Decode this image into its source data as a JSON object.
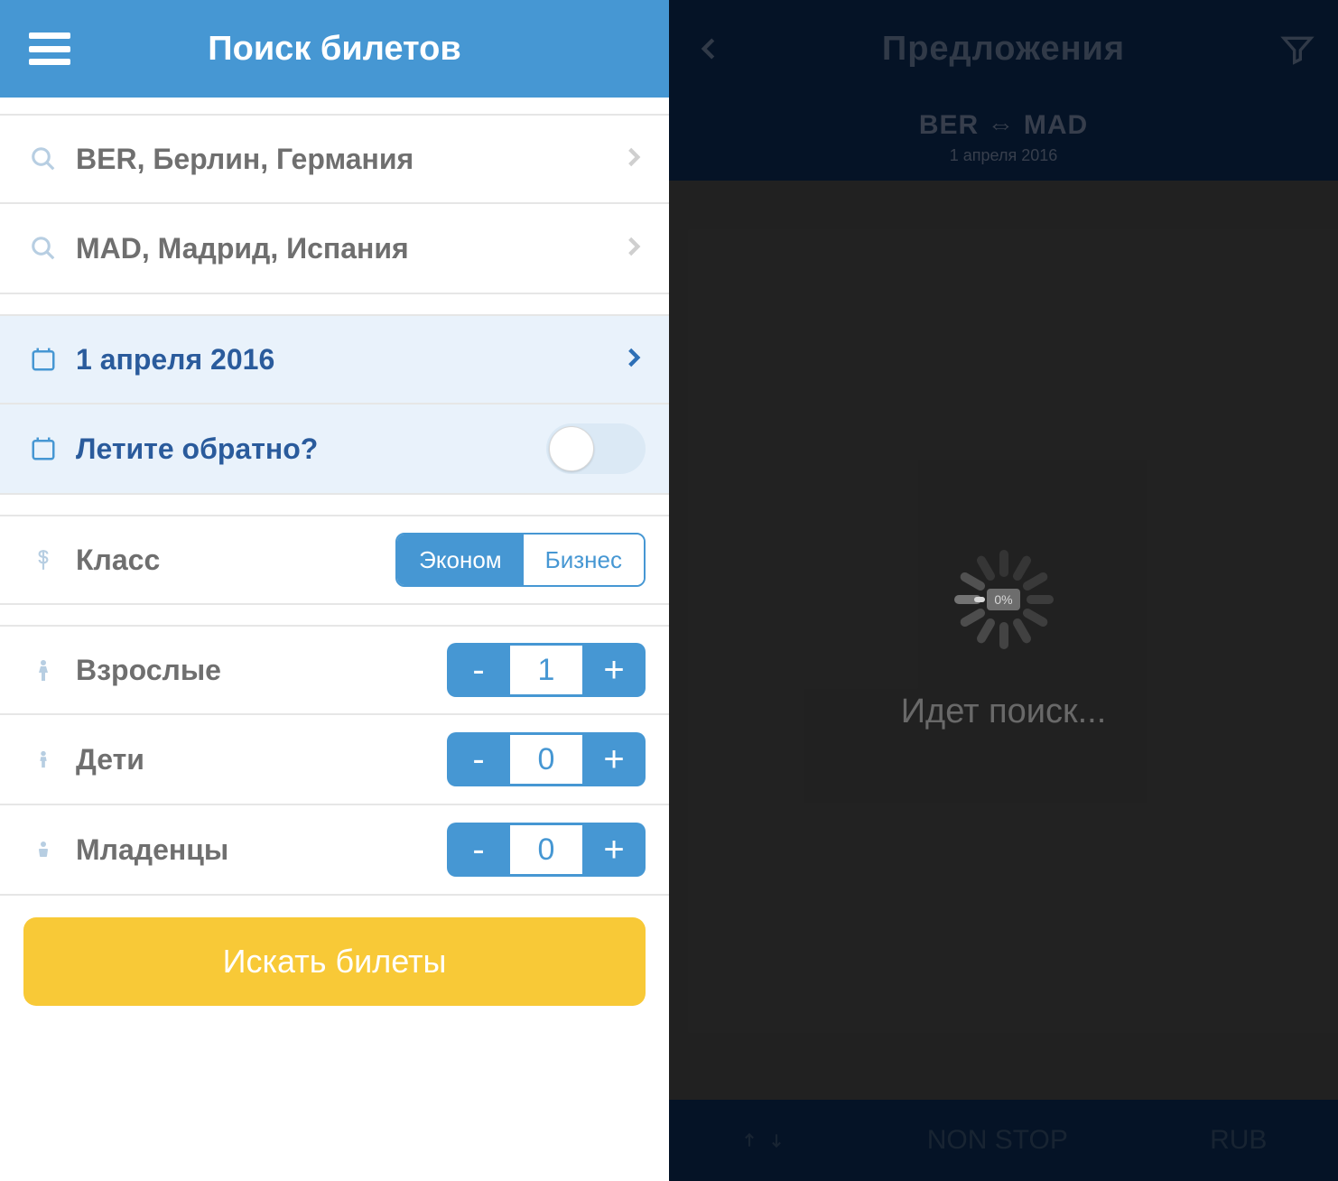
{
  "colors": {
    "primary": "#4697d3",
    "accent": "#f8c937",
    "highlight": "#e9f2fb",
    "dark_nav": "#0c2b55"
  },
  "left": {
    "title": "Поиск билетов",
    "origin": "BER, Берлин, Германия",
    "destination": "MAD, Мадрид, Испания",
    "depart_date": "1 апреля 2016",
    "return_label": "Летите обратно?",
    "return_toggle_on": false,
    "class_label": "Класс",
    "seg": {
      "economy": "Эконом",
      "business": "Бизнес",
      "active": "economy"
    },
    "pax": {
      "adults": {
        "label": "Взрослые",
        "value": 1
      },
      "children": {
        "label": "Дети",
        "value": 0
      },
      "infants": {
        "label": "Младенцы",
        "value": 0
      }
    },
    "search_button": "Искать билеты"
  },
  "right": {
    "title": "Предложения",
    "route": "BER ⇔ MAD",
    "date": "1 апреля 2016",
    "loading_text": "Идет поиск...",
    "progress_pct": "0%",
    "footer": {
      "nonstop": "NON STOP",
      "currency": "RUB"
    }
  }
}
